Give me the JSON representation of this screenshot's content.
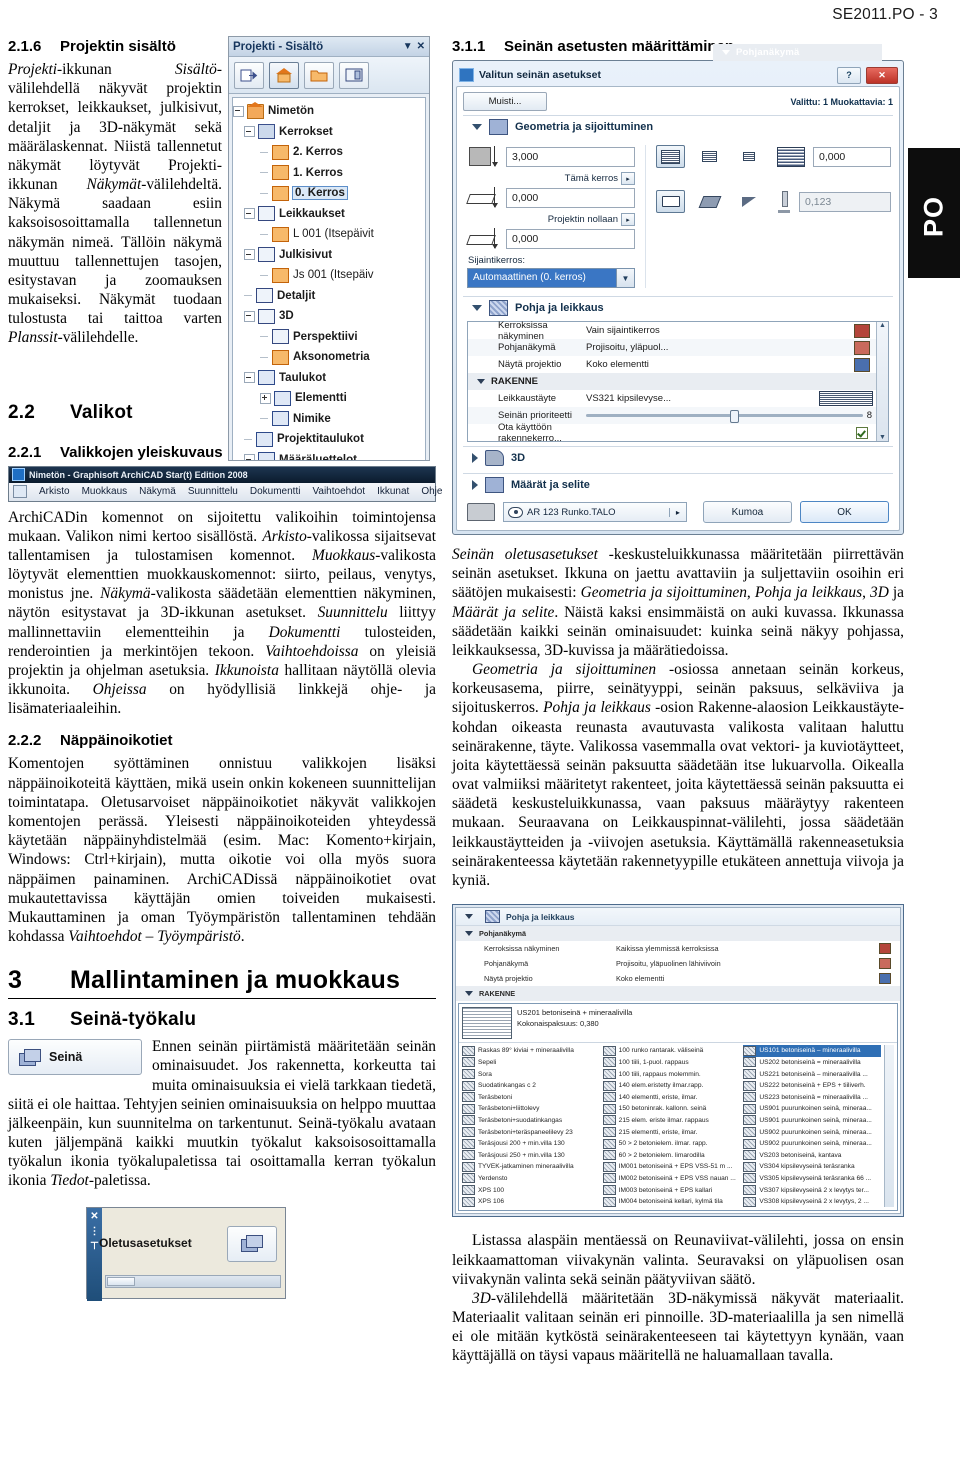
{
  "header": {
    "doc_ref": "SE2011.PO - 3"
  },
  "side_tab": {
    "label": "PO"
  },
  "left": {
    "sec216": {
      "num": "2.1.6",
      "title": "Projektin sisältö",
      "body_1": "Projekti",
      "body_2": "-ikkunan ",
      "body_3": "Sisältö",
      "body_4": "-välilehdellä näkyvät projektin kerrokset, leikkaukset, julkisivut, detaljit ja 3D-näkymät sekä määrälaskennat. Niistä tallennetut näkymät löytyvät Projekti-ikkunan ",
      "body_5": "Näkymät",
      "body_6": "-välilehdeltä. Näkymä saadaan esiin kaksoisosoittamalla tallennetun näkymän nimeä. Tällöin näkymä muuttuu tallennettujen tasojen, esitystavan ja zoomauksen mukaiseksi. Näkymät tuodaan tulostusta tai taittoa varten ",
      "body_7": "Planssit",
      "body_8": "-välilehdelle."
    },
    "sec22": {
      "num": "2.2",
      "title": "Valikot"
    },
    "sec221": {
      "num": "2.2.1",
      "title": "Valikkojen yleiskuvaus"
    },
    "para221": [
      {
        "t": "ArchiCADin komennot on sijoitettu valikoihin toimintojensa mukaan. Valikon nimi kertoo sisällöstä. ",
        "i": false
      },
      {
        "t": "Arkisto",
        "i": true
      },
      {
        "t": "-valikossa sijaitsevat tallentamisen ja tulostamisen komennot. ",
        "i": false
      },
      {
        "t": "Muokkaus",
        "i": true
      },
      {
        "t": "-valikosta löytyvät elementtien muokkauskomennot: siirto, peilaus, venytys, monistus jne. ",
        "i": false
      },
      {
        "t": "Näkymä",
        "i": true
      },
      {
        "t": "-valikosta säädetään elementtien näkyminen, näytön esitystavat ja 3D-ikkunan asetukset. ",
        "i": false
      },
      {
        "t": "Suunnittelu",
        "i": true
      },
      {
        "t": " liittyy mallinnettaviin elementteihin ja ",
        "i": false
      },
      {
        "t": "Dokumentti",
        "i": true
      },
      {
        "t": " tulosteiden, renderointien ja merkintöjen tekoon. ",
        "i": false
      },
      {
        "t": "Vaihtoehdoissa",
        "i": true
      },
      {
        "t": " on yleisiä projektin ja ohjelman asetuksia. ",
        "i": false
      },
      {
        "t": "Ikkunoista",
        "i": true
      },
      {
        "t": " hallitaan näytöllä olevia ikkunoita. ",
        "i": false
      },
      {
        "t": "Ohjeissa",
        "i": true
      },
      {
        "t": " on hyödyllisiä linkkejä ohje- ja lisämateriaaleihin.",
        "i": false
      }
    ],
    "sec222": {
      "num": "2.2.2",
      "title": "Näppäinoikotiet"
    },
    "para222": [
      {
        "t": "Komentojen syöttäminen onnistuu valikkojen lisäksi näppäinoikoteitä käyttäen, mikä usein onkin kokeneen suunnittelijan toimintatapa. Oletusarvoiset näppäinoikotiet näkyvät valikkojen komentojen perässä. Yleisesti näppäinoikoteiden yhteydessä käytetään näppäinyhdistelmää (esim. Mac: Komento+kirjain, Windows: Ctrl+kirjain), mutta oikotie voi olla myös suora näppäimen painaminen. ArchiCADissä näppäinoikotiet ovat mukautettavissa käyttäjän omien toiveiden mukaisesti. Mukauttaminen ja oman Työympäristön tallentaminen tehdään kohdassa ",
        "i": false
      },
      {
        "t": "Vaihtoehdot – Työympäristö",
        "i": true
      },
      {
        "t": ".",
        "i": false
      }
    ],
    "sec3": {
      "num": "3",
      "title": "Mallintaminen ja muokkaus"
    },
    "sec31": {
      "num": "3.1",
      "title": "Seinä-työkalu"
    },
    "para31": [
      {
        "t": "Ennen seinän piirtämistä määritetään seinän ominaisuudet. Jos rakennetta, korkeutta tai muita ominaisuuksia ei vielä tarkkaan tiedetä, siitä ei ole haittaa. Tehtyjen seinien ominaisuuksia on helppo muuttaa jälkeenpäin, kun suunnitelma on tarkentunut. Seinä-työkalu avataan kuten jäljempänä kaikki muutkin työkalut kaksoisosoittamalla työkalun ikonia työkalupaletissa tai osoittamalla kerran työkalun ikonia ",
        "i": false
      },
      {
        "t": "Tiedot",
        "i": true
      },
      {
        "t": "-paletissa.",
        "i": false
      }
    ]
  },
  "right": {
    "sec311": {
      "num": "3.1.1",
      "title": "Seinän asetusten määrittäminen"
    },
    "para311_a": [
      {
        "t": "Seinän oletusasetukset",
        "i": true
      },
      {
        "t": " -keskusteluikkunassa määritetään piirrettävän seinän asetukset. Ikkuna on jaettu avattaviin ja suljettaviin osoihin eri säätöjen mukaisesti: ",
        "i": false
      },
      {
        "t": "Geometria ja sijoittuminen",
        "i": true
      },
      {
        "t": ", ",
        "i": false
      },
      {
        "t": "Pohja ja leikkaus",
        "i": true
      },
      {
        "t": ", ",
        "i": false
      },
      {
        "t": "3D",
        "i": true
      },
      {
        "t": " ja ",
        "i": false
      },
      {
        "t": "Määrät ja selite",
        "i": true
      },
      {
        "t": ". Näistä kaksi ensimmäistä on auki kuvassa. Ikkunassa säädetään kaikki seinän ominaisuudet: kuinka seinä näkyy pohjassa, leikkauksessa, 3D-kuvissa ja määrätiedoissa.",
        "i": false
      }
    ],
    "para311_b": [
      {
        "t": "Geometria ja sijoittuminen",
        "i": true
      },
      {
        "t": " -osiossa annetaan seinän korkeus, korkeusasema, piirre, seinätyyppi, seinän paksuus, selkäviiva ja sijoituskerros. ",
        "i": false
      },
      {
        "t": "Pohja ja leikkaus",
        "i": true
      },
      {
        "t": " -osion Rakenne-alaosion Leikkaustäyte-kohdan oikeasta reunasta avautuvasta valikosta valitaan haluttu seinärakenne, täyte. Valikossa vasemmalla ovat vektori- ja kuviotäytteet, joita käytettäessä seinän paksuutta säädetään itse lukuarvolla. Oikealla ovat valmiiksi määritetyt rakenteet, joita käytettäessä seinän paksuutta ei säädetä keskusteluikkunassa, vaan paksuus määräytyy rakenteen mukaan. Seuraavana on Leikkauspinnat-välilehti, jossa säädetään leikkaustäytteiden ja -viivojen asetuksia. Käyttämällä rakenneasetuksia seinärakenteessa käytetään rakennetyypille etukäteen annettuja viivoja ja kyniä.",
        "i": false
      }
    ],
    "para311_c": [
      {
        "t": "Listassa alaspäin mentäessä on Reunaviivat-välilehti, jossa on ensin leikkaamattoman viivakynän valinta. Seuravaksi on yläpuolisen osan viivakynän valinta sekä seinän päätyviivan säätö.",
        "i": false
      }
    ],
    "para311_d": [
      {
        "t": "3D",
        "i": true
      },
      {
        "t": "-välilehdellä määritetään 3D-näkymissä näkyvät materiaalit. Materiaalit valitaan seinän eri pinnoille. 3D-materiaalilla ja sen nimellä ei ole mitään kytköstä seinärakenteeseen tai käytettyyn kynään, vaan käyttäjällä on täysi vapaus määritellä ne haluamallaan tavalla.",
        "i": false
      }
    ]
  },
  "fig_project_palette": {
    "title": "Projekti - Sisältö",
    "controls": {
      "collapse": "▼",
      "close": "✕"
    },
    "toolbar_icons": [
      "export-icon",
      "project-house-icon",
      "folder-icon",
      "layout-icon"
    ],
    "tree": [
      {
        "label": "Nimetön",
        "indent": 0,
        "icon": "house-icon",
        "expander": "minus",
        "selected": false,
        "bold": true
      },
      {
        "label": "Kerrokset",
        "indent": 1,
        "icon": "stories-icon",
        "expander": "minus",
        "selected": false,
        "bold": true
      },
      {
        "label": "2. Kerros",
        "indent": 2,
        "icon": "story-icon",
        "expander": "none",
        "selected": false,
        "bold": true
      },
      {
        "label": "1. Kerros",
        "indent": 2,
        "icon": "story-icon",
        "expander": "none",
        "selected": false,
        "bold": true
      },
      {
        "label": "0. Kerros",
        "indent": 2,
        "icon": "story-icon",
        "expander": "none",
        "selected": true,
        "bold": true
      },
      {
        "label": "Leikkaukset",
        "indent": 1,
        "icon": "section-icon",
        "expander": "minus",
        "selected": false,
        "bold": true
      },
      {
        "label": "L 001 (Itsepäivit",
        "indent": 2,
        "icon": "section-view-icon",
        "expander": "none",
        "selected": false,
        "bold": false
      },
      {
        "label": "Julkisivut",
        "indent": 1,
        "icon": "elevation-icon",
        "expander": "minus",
        "selected": false,
        "bold": true
      },
      {
        "label": "Js 001 (Itsepäiv",
        "indent": 2,
        "icon": "elevation-view-icon",
        "expander": "none",
        "selected": false,
        "bold": false
      },
      {
        "label": "Detaljit",
        "indent": 1,
        "icon": "detail-icon",
        "expander": "none",
        "selected": false,
        "bold": true
      },
      {
        "label": "3D",
        "indent": 1,
        "icon": "3d-icon",
        "expander": "minus",
        "selected": false,
        "bold": true
      },
      {
        "label": "Perspektiivi",
        "indent": 2,
        "icon": "camera-icon",
        "expander": "none",
        "selected": false,
        "bold": true
      },
      {
        "label": "Aksonometria",
        "indent": 2,
        "icon": "axonometry-icon",
        "expander": "none",
        "selected": false,
        "bold": true
      },
      {
        "label": "Taulukot",
        "indent": 1,
        "icon": "schedule-icon",
        "expander": "minus",
        "selected": false,
        "bold": true
      },
      {
        "label": "Elementti",
        "indent": 2,
        "icon": "element-icon",
        "expander": "plus",
        "selected": false,
        "bold": true
      },
      {
        "label": "Nimike",
        "indent": 2,
        "icon": "item-icon",
        "expander": "none",
        "selected": false,
        "bold": true
      },
      {
        "label": "Projektitaulukot",
        "indent": 1,
        "icon": "project-table-icon",
        "expander": "none",
        "selected": false,
        "bold": true
      },
      {
        "label": "Määräluettelot",
        "indent": 1,
        "icon": "quantity-icon",
        "expander": "minus",
        "selected": false,
        "bold": true
      }
    ]
  },
  "fig_menubar": {
    "window_title": "Nimetön - Graphisoft ArchiCAD Star(t) Edition 2008",
    "menus": [
      "Arkisto",
      "Muokkaus",
      "Näkymä",
      "Suunnittelu",
      "Dokumentti",
      "Vaihtoehdot",
      "Ikkunat",
      "Ohje"
    ]
  },
  "fig_wall_tool": {
    "label": "Seinä"
  },
  "fig_oletus": {
    "label": "Oletusasetukset",
    "close": "✕"
  },
  "fig_wall_dialog": {
    "title": "Valitun seinän asetukset",
    "help_btn": "?",
    "close_btn": "✕",
    "memory_btn": "Muisti...",
    "selection_info": "Valittu: 1 Muokattavia: 1",
    "sections": [
      {
        "name": "Geometria ja sijoittuminen",
        "open": true
      },
      {
        "name": "Pohja ja leikkaus",
        "open": true
      },
      {
        "name": "3D",
        "open": false
      },
      {
        "name": "Määrät ja selite",
        "open": false
      }
    ],
    "geometry": {
      "height": "3,000",
      "label_this_story": "Tämä kerros",
      "base_offset": "0,000",
      "label_project_zero": "Projektin nollaan",
      "project_offset": "0,000",
      "home_story_label": "Sijaintikerros:",
      "home_story_value": "Automaattinen (0. kerros)",
      "thickness": "0,000",
      "second_value": "0,123"
    },
    "plan_section_rows": [
      {
        "label": "Pohjanäkymä",
        "value": "",
        "group": true,
        "selected": true
      },
      {
        "label": "Kerroksissa näkyminen",
        "value": "Vain sijaintikerros",
        "swatch": "red"
      },
      {
        "label": "Pohjanäkymä",
        "value": "Projisoitu, yläpuol...",
        "swatch": "red2"
      },
      {
        "label": "Näytä projektio",
        "value": "Koko elementti",
        "swatch": "blue"
      },
      {
        "label": "RAKENNE",
        "value": "",
        "group": true
      },
      {
        "label": "Leikkaustäyte",
        "value": "VS321 kipsilevyse...",
        "swatch": "stripe"
      },
      {
        "label": "Seinän prioriteetti",
        "value": "8",
        "swatch": "yellow",
        "slider": true
      },
      {
        "label": "Ota käyttöön rakennekerro...",
        "value": "",
        "checkbox": true
      }
    ],
    "footer": {
      "attribute": "AR 123 Runko.TALO",
      "cancel": "Kumoa",
      "ok": "OK"
    }
  },
  "fig_structure_picker": {
    "section_title": "Pohja ja leikkaus",
    "rows": [
      {
        "label": "Pohjanäkymä",
        "value": "",
        "group": true
      },
      {
        "label": "Kerroksissa näkyminen",
        "value": "Kaikissa ylemmissä kerroksissa"
      },
      {
        "label": "Pohjanäkymä",
        "value": "Projisoitu, yläpuolinen lähiviivoin"
      },
      {
        "label": "Näytä projektio",
        "value": "Koko elementti"
      },
      {
        "label": "RAKENNE",
        "value": "",
        "group": true
      }
    ],
    "preview": {
      "name": "US201 betoniseinä + mineraalivilla",
      "thickness": "Kokonaispaksuus: 0,380"
    },
    "col1": [
      "Raskas 89° kiviai + mineraalivilla",
      "Sepeli",
      "Sora",
      "Suodatinkangas c 2",
      "Teräsbetoni",
      "Teräsbetoni+liittolevy",
      "Teräsbetoni+suodatinkangas",
      "Teräsbetoni+teräspaneelilevy 23",
      "Teräsjousi 200 + min.villa 130",
      "Teräsjousi 250 + min.villa 130",
      "TYVEK-jatkaminen mineraalivilla",
      "Yerdensto",
      "XPS 100",
      "XPS 106"
    ],
    "col2": [
      "100 runko rantarak. väliseinä",
      "100 tiili, 1-puol. rappaus",
      "100 tiili, rappaus molemmin.",
      "140 elem.eristetty ilmar.rapp.",
      "140 elementti, eriste, ilmar.",
      "150 betoninrak. kallonn. seinä",
      "215 elem. eriste ilmar. rappaus",
      "215 elementti, eriste, ilmar.",
      "50 > 2 betonielem. ilmar. rapp.",
      "60 > 2 betonielem. limarodilla",
      "IM001 betoniseinä + EPS VSS-51 m ...",
      "IM002 betoniseinä + EPS VSS nauan ...",
      "IM003 betoniseinä + EPS kallari",
      "IM004 betoniseinä kellari, kylmä tila"
    ],
    "col3": [
      "US101 betoniseinä – mineraalivilla",
      "US202 betoniseinä = mineraalivilla",
      "US221 betoniseinä – mineraalivilla ...",
      "US222 betoniseinä + EPS + tiiliverh.",
      "US223 betoniseinä = mineraalivilla ...",
      "US901 puurunkoinen seinä, mineraa...",
      "US901 puurunkoinen seinä, mineraa...",
      "US902 puurunkoinen seinä, mineraa...",
      "US902 puurunkoinen seinä, mineraa...",
      "VS203 betoniseinä, kantava",
      "VS304 kipsilevyseinä teräsranka",
      "VS305 kipsilevyseinä teräsranka 66 ...",
      "VS307 kipsilevyseinä 2 x levytys ter...",
      "VS308 kipsilevyseinä 2 x levytys, 2 ..."
    ],
    "selected_item": "US101 betoniseinä – mineraalivilla"
  }
}
